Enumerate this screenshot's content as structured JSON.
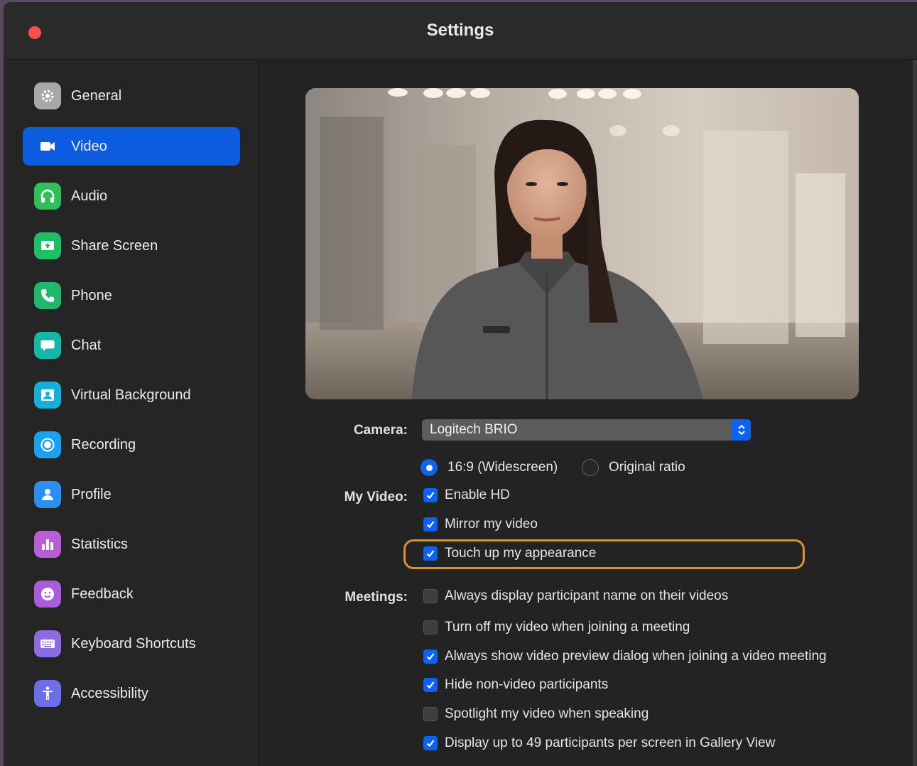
{
  "window": {
    "title": "Settings"
  },
  "sidebar": {
    "items": [
      {
        "label": "General",
        "icon": "gear-icon",
        "color": "#a8a8a8",
        "active": false
      },
      {
        "label": "Video",
        "icon": "video-camera-icon",
        "color": "#0b5cde",
        "active": true
      },
      {
        "label": "Audio",
        "icon": "headphones-icon",
        "color": "#2fbf5b",
        "active": false
      },
      {
        "label": "Share Screen",
        "icon": "share-screen-icon",
        "color": "#1fbf66",
        "active": false
      },
      {
        "label": "Phone",
        "icon": "phone-icon",
        "color": "#22b86b",
        "active": false
      },
      {
        "label": "Chat",
        "icon": "chat-bubble-icon",
        "color": "#16b7a7",
        "active": false
      },
      {
        "label": "Virtual Background",
        "icon": "virtual-background-icon",
        "color": "#17aeda",
        "active": false
      },
      {
        "label": "Recording",
        "icon": "record-icon",
        "color": "#1aa2f0",
        "active": false
      },
      {
        "label": "Profile",
        "icon": "person-icon",
        "color": "#2a8ef2",
        "active": false
      },
      {
        "label": "Statistics",
        "icon": "bar-chart-icon",
        "color": "#b85fd6",
        "active": false
      },
      {
        "label": "Feedback",
        "icon": "smiley-icon",
        "color": "#a85ed8",
        "active": false
      },
      {
        "label": "Keyboard Shortcuts",
        "icon": "keyboard-icon",
        "color": "#8f6ae0",
        "active": false
      },
      {
        "label": "Accessibility",
        "icon": "accessibility-icon",
        "color": "#6d6fe6",
        "active": false
      }
    ]
  },
  "video": {
    "camera_label": "Camera:",
    "camera_value": "Logitech BRIO",
    "my_video_label": "My Video:",
    "ratio_options": [
      {
        "label": "16:9 (Widescreen)",
        "selected": true
      },
      {
        "label": "Original ratio",
        "selected": false
      }
    ],
    "my_video_options": [
      {
        "label": "Enable HD",
        "checked": true
      },
      {
        "label": "Mirror my video",
        "checked": true
      },
      {
        "label": "Touch up my appearance",
        "checked": true
      }
    ],
    "meetings_label": "Meetings:",
    "meetings_options": [
      {
        "label": "Always display participant name on their videos",
        "checked": false
      },
      {
        "label": "Turn off my video when joining a meeting",
        "checked": false
      },
      {
        "label": "Always show video preview dialog when joining a video meeting",
        "checked": true
      },
      {
        "label": "Hide non-video participants",
        "checked": true
      },
      {
        "label": "Spotlight my video when speaking",
        "checked": false
      },
      {
        "label": "Display up to 49 participants per screen in Gallery View",
        "checked": true
      }
    ]
  },
  "colors": {
    "accent": "#0b63f5",
    "highlight": "#e0922e",
    "close": "#fe4f4b"
  }
}
